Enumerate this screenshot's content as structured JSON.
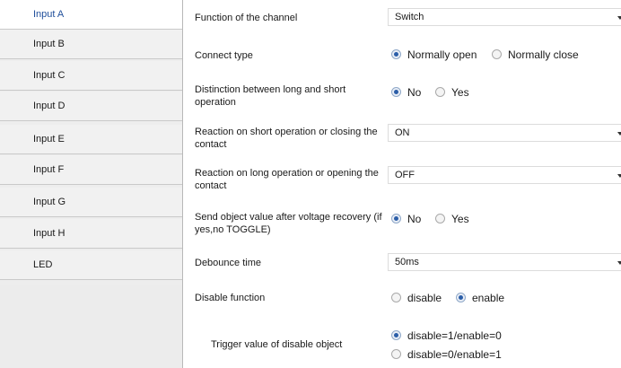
{
  "sidebar": {
    "items": [
      {
        "label": "Input A"
      },
      {
        "label": "Input B"
      },
      {
        "label": "Input C"
      },
      {
        "label": "Input D"
      },
      {
        "label": "Input E"
      },
      {
        "label": "Input F"
      },
      {
        "label": "Input G"
      },
      {
        "label": "Input H"
      },
      {
        "label": "LED"
      }
    ],
    "active": "Input A"
  },
  "settings": {
    "function_of_channel": {
      "label": "Function of the channel",
      "value": "Switch"
    },
    "connect_type": {
      "label": "Connect type",
      "options": [
        "Normally open",
        "Normally close"
      ],
      "selected": "Normally open"
    },
    "distinction": {
      "label_line1": "Distinction between long and short",
      "label_line2": "operation",
      "options": [
        "No",
        "Yes"
      ],
      "selected": "No"
    },
    "reaction_short": {
      "label_line1": "Reaction on short operation or closing the",
      "label_line2": "contact",
      "value": "ON"
    },
    "reaction_long": {
      "label_line1": "Reaction on long operation or opening the",
      "label_line2": "contact",
      "value": "OFF"
    },
    "send_object": {
      "label_line1": "Send object value after voltage recovery (if",
      "label_line2": "yes,no TOGGLE)",
      "options": [
        "No",
        "Yes"
      ],
      "selected": "No"
    },
    "debounce_time": {
      "label": "Debounce time",
      "value": "50ms"
    },
    "disable_function": {
      "label": "Disable function",
      "options": [
        "disable",
        "enable"
      ],
      "selected": "enable"
    },
    "trigger_value": {
      "label": "Trigger value of disable object",
      "options": [
        "disable=1/enable=0",
        "disable=0/enable=1"
      ],
      "selected": "disable=1/enable=0"
    }
  },
  "colors": {
    "active_item_text": "#1f4e9a",
    "radio_dot": "#2b5ea8"
  },
  "icons": {
    "dropdown": "chevron-down-icon",
    "radio_selected": "radio-selected-icon",
    "radio_unselected": "radio-unselected-icon"
  }
}
